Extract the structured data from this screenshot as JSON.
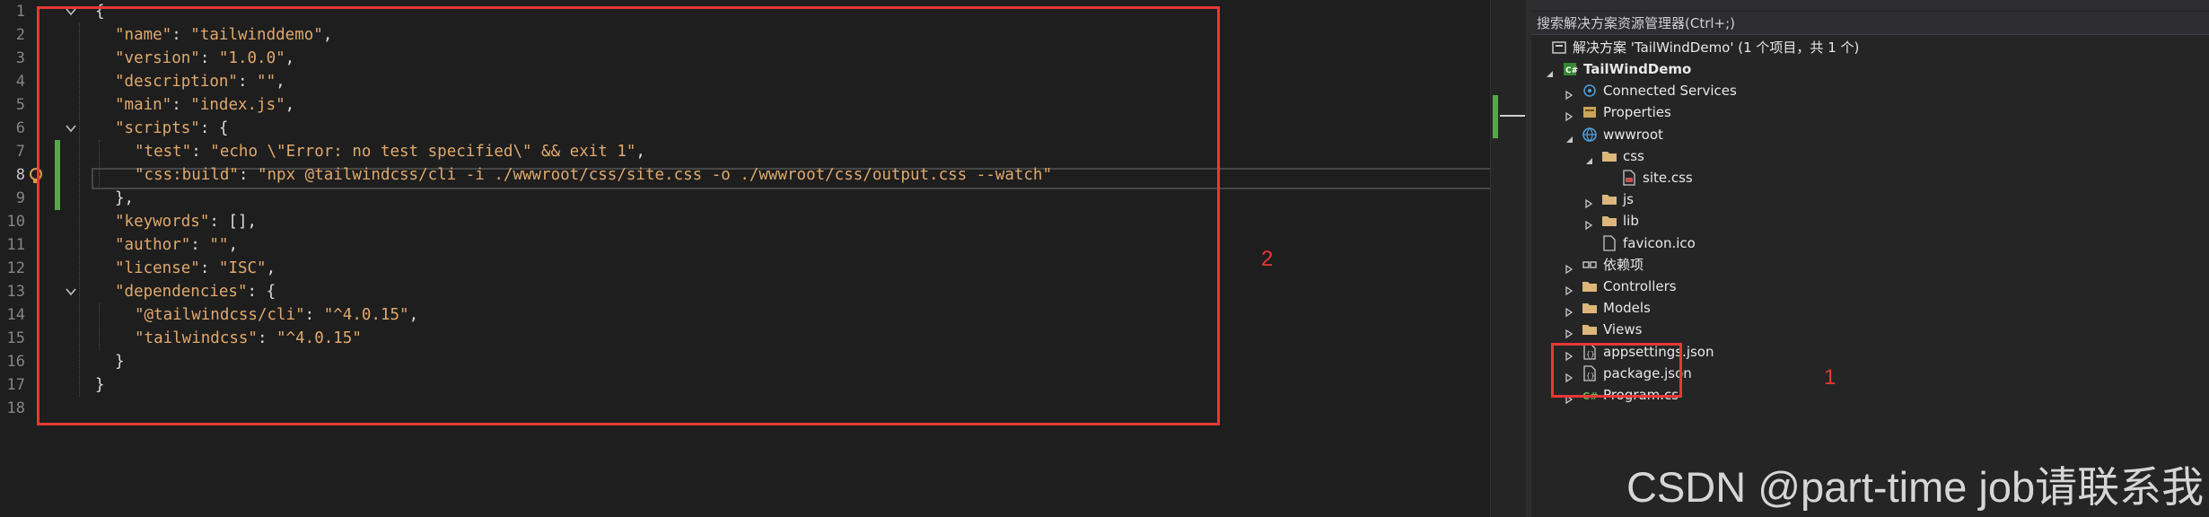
{
  "editor": {
    "line_numbers": [
      "1",
      "2",
      "3",
      "4",
      "5",
      "6",
      "7",
      "8",
      "9",
      "10",
      "11",
      "12",
      "13",
      "14",
      "15",
      "16",
      "17",
      "18"
    ],
    "active_line": "8",
    "lines": [
      [
        [
          "p",
          "{"
        ]
      ],
      [
        [
          "k",
          "\"name\""
        ],
        [
          "p",
          ": "
        ],
        [
          "s",
          "\"tailwinddemo\""
        ],
        [
          "p",
          ","
        ]
      ],
      [
        [
          "k",
          "\"version\""
        ],
        [
          "p",
          ": "
        ],
        [
          "s",
          "\"1.0.0\""
        ],
        [
          "p",
          ","
        ]
      ],
      [
        [
          "k",
          "\"description\""
        ],
        [
          "p",
          ": "
        ],
        [
          "s",
          "\"\""
        ],
        [
          "p",
          ","
        ]
      ],
      [
        [
          "k",
          "\"main\""
        ],
        [
          "p",
          ": "
        ],
        [
          "s",
          "\"index.js\""
        ],
        [
          "p",
          ","
        ]
      ],
      [
        [
          "k",
          "\"scripts\""
        ],
        [
          "p",
          ": {"
        ]
      ],
      [
        [
          "k",
          "\"test\""
        ],
        [
          "p",
          ": "
        ],
        [
          "s",
          "\"echo \\\"Error: no test specified\\\" && exit 1\""
        ],
        [
          "p",
          ","
        ]
      ],
      [
        [
          "k",
          "\"css:build\""
        ],
        [
          "p",
          ": "
        ],
        [
          "s",
          "\"npx @tailwindcss/cli -i ./wwwroot/css/site.css -o ./wwwroot/css/output.css --watch\""
        ]
      ],
      [
        [
          "p",
          "},"
        ]
      ],
      [
        [
          "k",
          "\"keywords\""
        ],
        [
          "p",
          ": [],"
        ]
      ],
      [
        [
          "k",
          "\"author\""
        ],
        [
          "p",
          ": "
        ],
        [
          "s",
          "\"\""
        ],
        [
          "p",
          ","
        ]
      ],
      [
        [
          "k",
          "\"license\""
        ],
        [
          "p",
          ": "
        ],
        [
          "s",
          "\"ISC\""
        ],
        [
          "p",
          ","
        ]
      ],
      [
        [
          "k",
          "\"dependencies\""
        ],
        [
          "p",
          ": {"
        ]
      ],
      [
        [
          "k",
          "\"@tailwindcss/cli\""
        ],
        [
          "p",
          ": "
        ],
        [
          "s",
          "\"^4.0.15\""
        ],
        [
          "p",
          ","
        ]
      ],
      [
        [
          "k",
          "\"tailwindcss\""
        ],
        [
          "p",
          ": "
        ],
        [
          "s",
          "\"^4.0.15\""
        ]
      ],
      [
        [
          "p",
          "}"
        ]
      ],
      [
        [
          "p",
          "}"
        ]
      ],
      []
    ]
  },
  "annotations": {
    "editor_box_number": "2",
    "package_box_number": "1"
  },
  "explorer": {
    "search_placeholder": "搜索解决方案资源管理器(Ctrl+;)",
    "solution_label": "解决方案 'TailWindDemo' (1 个项目，共 1 个)",
    "items": [
      {
        "label": "TailWindDemo",
        "icon": "csharp-project-icon",
        "expanded": true
      },
      {
        "label": "Connected Services",
        "icon": "connected-services-icon",
        "expanded": false
      },
      {
        "label": "Properties",
        "icon": "properties-icon",
        "expanded": false
      },
      {
        "label": "wwwroot",
        "icon": "globe-icon",
        "expanded": true
      },
      {
        "label": "css",
        "icon": "folder-icon",
        "expanded": true
      },
      {
        "label": "site.css",
        "icon": "css-file-icon"
      },
      {
        "label": "js",
        "icon": "folder-icon",
        "expanded": false
      },
      {
        "label": "lib",
        "icon": "folder-icon",
        "expanded": false
      },
      {
        "label": "favicon.ico",
        "icon": "file-icon"
      },
      {
        "label": "依赖项",
        "icon": "dependencies-icon",
        "expanded": false
      },
      {
        "label": "Controllers",
        "icon": "folder-icon",
        "expanded": false
      },
      {
        "label": "Models",
        "icon": "folder-icon",
        "expanded": false
      },
      {
        "label": "Views",
        "icon": "folder-icon",
        "expanded": false
      },
      {
        "label": "appsettings.json",
        "icon": "json-file-icon",
        "expanded": false
      },
      {
        "label": "package.json",
        "icon": "json-file-icon",
        "expanded": false
      },
      {
        "label": "Program.cs",
        "icon": "csharp-file-icon",
        "expanded": false
      }
    ]
  },
  "watermark": "CSDN @part-time job请联系我",
  "colors": {
    "key": "#e0a96d",
    "string": "#e0a96d",
    "punct": "#dcdcdc",
    "annotation_red": "#e53935",
    "change_green": "#57a64a"
  }
}
